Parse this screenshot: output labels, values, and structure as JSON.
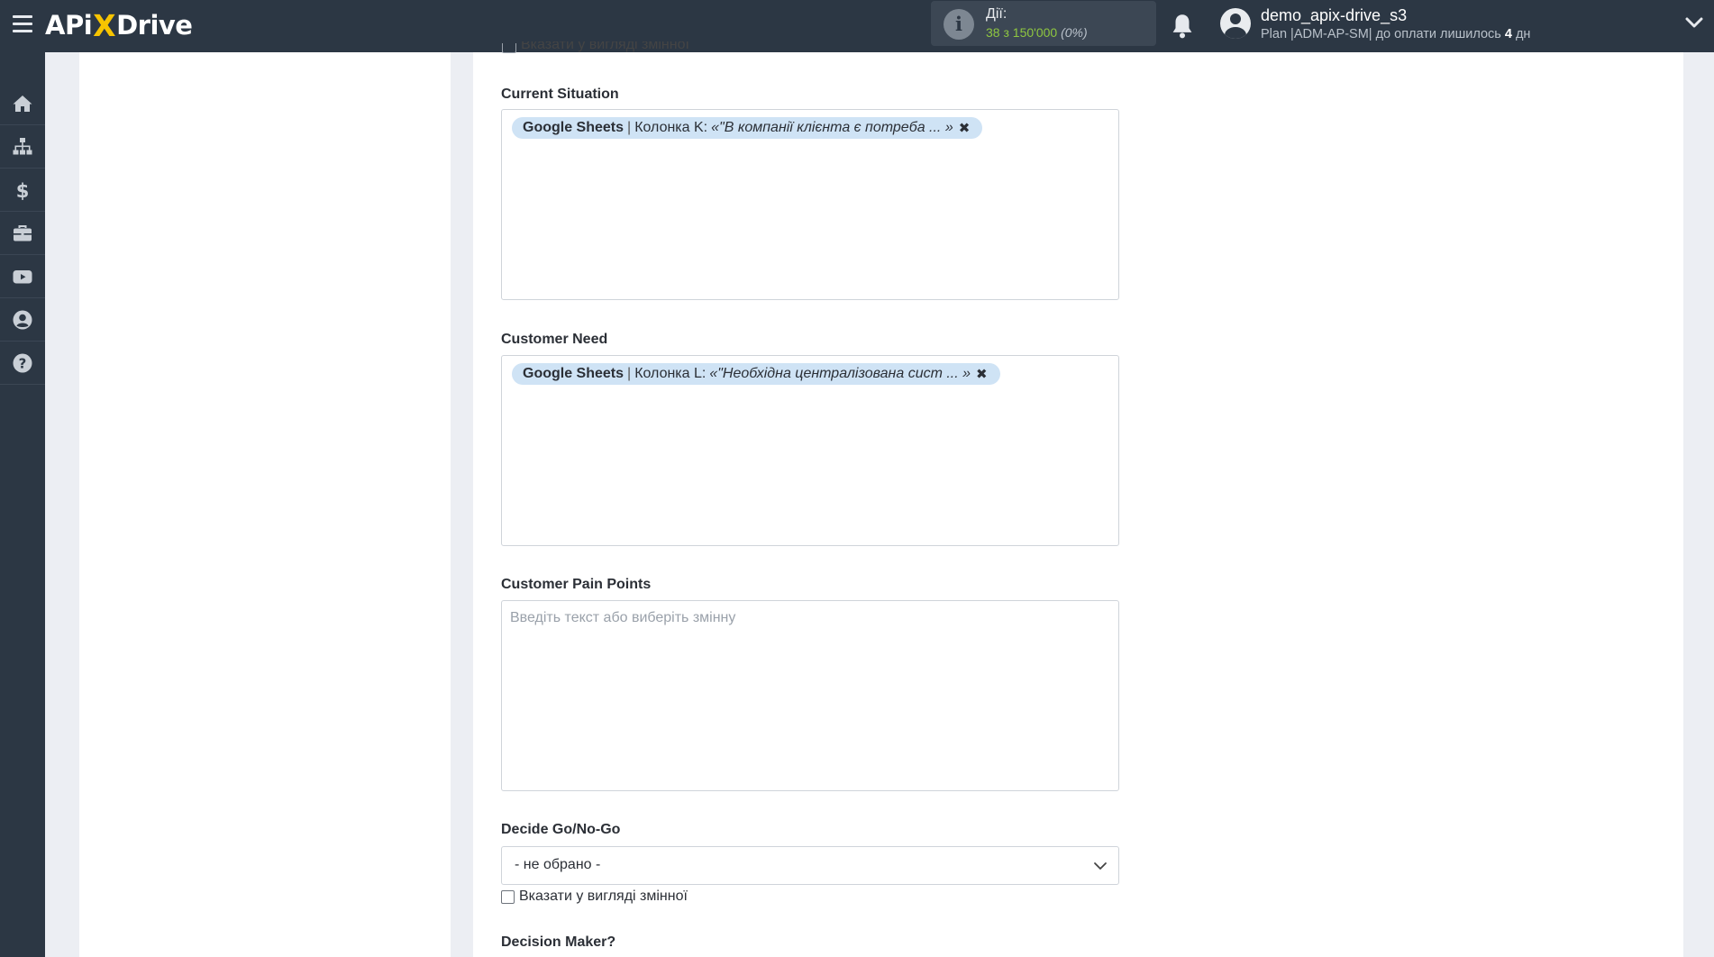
{
  "header": {
    "logo": {
      "left": "APi",
      "x": "X",
      "right": "Drive"
    },
    "actions": {
      "label": "Дії:",
      "used": "38",
      "of_text": "з",
      "limit": "150'000",
      "percent": "(0%)"
    },
    "user": {
      "name": "demo_apix-drive_s3",
      "plan_text": "Plan |ADM-AP-SM| до оплати лишилось",
      "days_left": "4",
      "days_unit": "дн"
    }
  },
  "sidebar": {
    "items": [
      {
        "icon": "home-icon"
      },
      {
        "icon": "sitemap-icon"
      },
      {
        "icon": "dollar-icon"
      },
      {
        "icon": "briefcase-icon"
      },
      {
        "icon": "video-icon"
      },
      {
        "icon": "user-circle-icon"
      },
      {
        "icon": "help-icon"
      }
    ]
  },
  "form": {
    "truncated_checkbox_label": "Вказати у вигляді змінної",
    "fields": [
      {
        "label": "Current Situation",
        "tag": {
          "service": "Google Sheets",
          "separator": "|",
          "column": "Колонка K:",
          "value": "«\"В компанії клієнта є потреба ... »",
          "remove": "✖"
        }
      },
      {
        "label": "Customer Need",
        "tag": {
          "service": "Google Sheets",
          "separator": "|",
          "column": "Колонка L:",
          "value": "«\"Необхідна централізована сист ... »",
          "remove": "✖"
        }
      },
      {
        "label": "Customer Pain Points",
        "placeholder": "Введіть текст або виберіть змінну"
      },
      {
        "label": "Decide Go/No-Go",
        "selected": "- не обрано -",
        "checkbox_label": "Вказати у вигляді змінної"
      },
      {
        "label": "Decision Maker?"
      }
    ]
  },
  "colors": {
    "topbar": "#2c3744",
    "accent_yellow": "#f7c400",
    "actions_green": "#8ec640",
    "tag_bg": "#cfe3f5"
  }
}
